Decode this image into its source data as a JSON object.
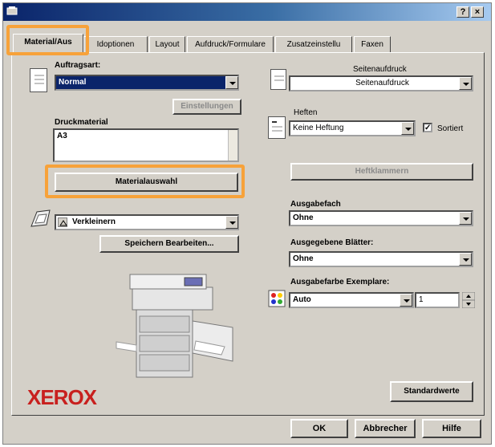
{
  "window": {
    "help_button": "?",
    "close_button": "×"
  },
  "tabs": [
    {
      "label": "Material/Aus"
    },
    {
      "label": "Idoptionen"
    },
    {
      "label": "Layout"
    },
    {
      "label": "Aufdruck/Formulare"
    },
    {
      "label": "Zusatzeinstellu"
    },
    {
      "label": "Faxen"
    }
  ],
  "left": {
    "auftragsart_label": "Auftragsart:",
    "auftragsart_value": "Normal",
    "einstellungen_button": "Einstellungen",
    "druckmaterial_label": "Druckmaterial",
    "druckmaterial_value": "A3",
    "materialauswahl_button": "Materialauswahl",
    "verkleinern_value": "Verkleinern",
    "speichern_button": "Speichern Bearbeiten..."
  },
  "right": {
    "seitenaufdruck_label": "Seitenaufdruck",
    "seitenaufdruck_value": "Seitenaufdruck",
    "heften_label": "Heften",
    "heften_value": "Keine Heftung",
    "sortiert_label": "Sortiert",
    "sortiert_checked_glyph": "✓",
    "heftklammern_button": "Heftklammern",
    "ausgabefach_label": "Ausgabefach",
    "ausgabefach_value": "Ohne",
    "ausgegebene_label": "Ausgegebene Blätter:",
    "ausgegebene_value": "Ohne",
    "ausgabefarbe_label": "Ausgabefarbe Exemplare:",
    "ausgabefarbe_value": "Auto",
    "exemplare_value": "1"
  },
  "brand": "XEROX",
  "buttons": {
    "standardwerte": "Standardwerte",
    "ok": "OK",
    "abbrechen": "Abbrecher",
    "hilfe": "Hilfe"
  },
  "colors": {
    "highlight": "#f7a23a",
    "title_bar": "#0a246a",
    "brand": "#c8201e"
  }
}
